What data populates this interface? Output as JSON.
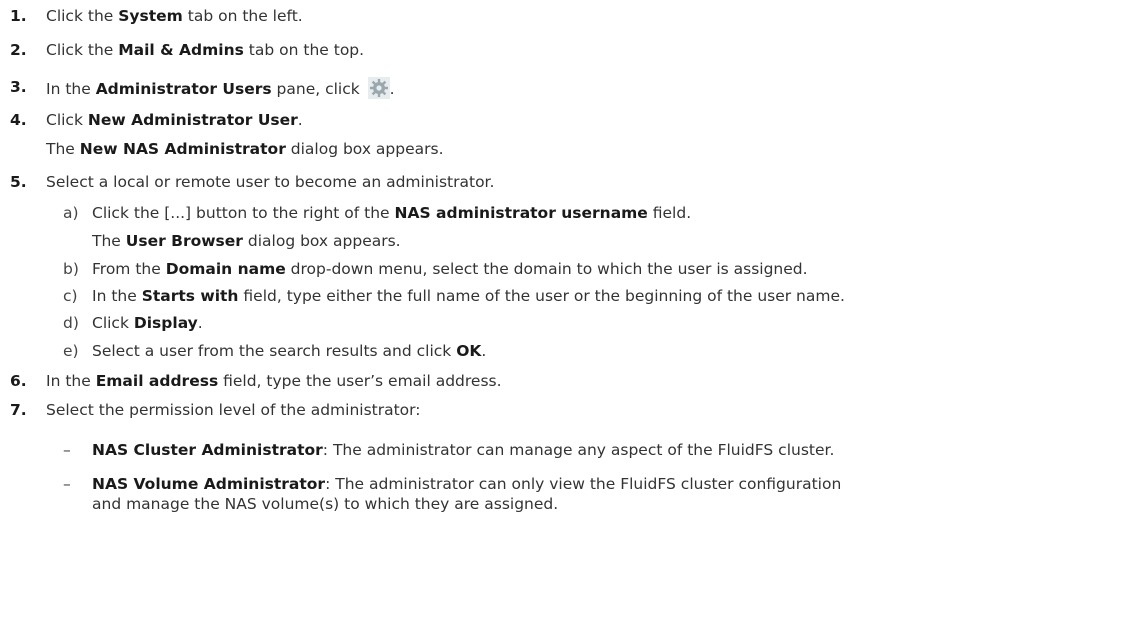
{
  "steps": {
    "s1": {
      "num": "1.",
      "a": "Click the ",
      "b1": "System",
      "c": " tab on the left."
    },
    "s2": {
      "num": "2.",
      "a": "Click the ",
      "b1": "Mail & Admins",
      "c": " tab on the top."
    },
    "s3": {
      "num": "3.",
      "a": "In the ",
      "b1": "Administrator Users",
      "c": " pane, click ",
      "d": "."
    },
    "s4": {
      "num": "4.",
      "a": "Click ",
      "b1": "New Administrator User",
      "c": ".",
      "r_a": "The ",
      "r_b": "New NAS Administrator",
      "r_c": " dialog box appears."
    },
    "s5": {
      "num": "5.",
      "a": "Select a local or remote user to become an administrator."
    },
    "s5a": {
      "letter": "a)",
      "a": "Click the [...] button to the right of the ",
      "b1": "NAS administrator username",
      "c": " field.",
      "r_a": "The ",
      "r_b": "User Browser",
      "r_c": " dialog box appears."
    },
    "s5b": {
      "letter": "b)",
      "a": "From the ",
      "b1": "Domain name",
      "c": " drop-down menu, select the domain to which the user is assigned."
    },
    "s5c": {
      "letter": "c)",
      "a": "In the ",
      "b1": "Starts with",
      "c": " field, type either the full name of the user or the beginning of the user name."
    },
    "s5d": {
      "letter": "d)",
      "a": "Click ",
      "b1": "Display",
      "c": "."
    },
    "s5e": {
      "letter": "e)",
      "a": "Select a user from the search results and click ",
      "b1": "OK",
      "c": "."
    },
    "s6": {
      "num": "6.",
      "a": "In the ",
      "b1": "Email address",
      "c": " field, type the user’s email address."
    },
    "s7": {
      "num": "7.",
      "a": "Select the permission level of the administrator:"
    },
    "b1": {
      "dash": "–",
      "b1": "NAS Cluster Administrator",
      "c": ": The administrator can manage any aspect of the FluidFS cluster."
    },
    "b2": {
      "dash": "–",
      "b1": "NAS Volume Administrator",
      "c": ": The administrator can only view the FluidFS cluster configuration",
      "line2": "and manage the NAS volume(s) to which they are assigned."
    }
  },
  "icons": {
    "settings": "gear-icon"
  }
}
